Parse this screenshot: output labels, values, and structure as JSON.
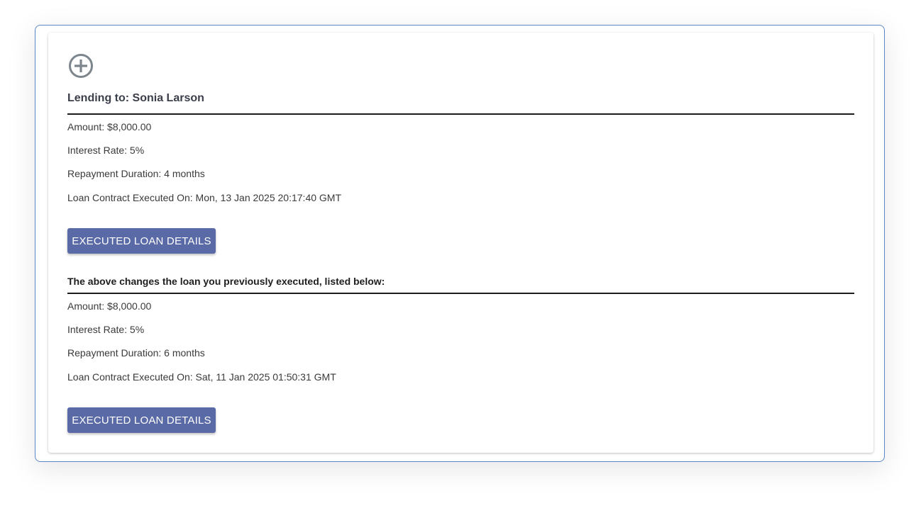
{
  "lending": {
    "heading": "Lending to: Sonia Larson",
    "amount": "Amount: $8,000.00",
    "interest_rate": "Interest Rate: 5%",
    "duration": "Repayment Duration: 4 months",
    "executed_on": "Loan Contract Executed On: Mon, 13 Jan 2025 20:17:40 GMT",
    "button_label": "EXECUTED LOAN DETAILS"
  },
  "previous": {
    "heading": "The above changes the loan you previously executed, listed below:",
    "amount": "Amount: $8,000.00",
    "interest_rate": "Interest Rate: 5%",
    "duration": "Repayment Duration: 6 months",
    "executed_on": "Loan Contract Executed On: Sat, 11 Jan 2025 01:50:31 GMT",
    "button_label": "EXECUTED LOAN DETAILS"
  },
  "icons": {
    "add": "add-circle-icon"
  },
  "colors": {
    "button_bg": "#5a6aa6",
    "frame_border": "#5b86c9",
    "icon_gray": "#7c868c"
  }
}
